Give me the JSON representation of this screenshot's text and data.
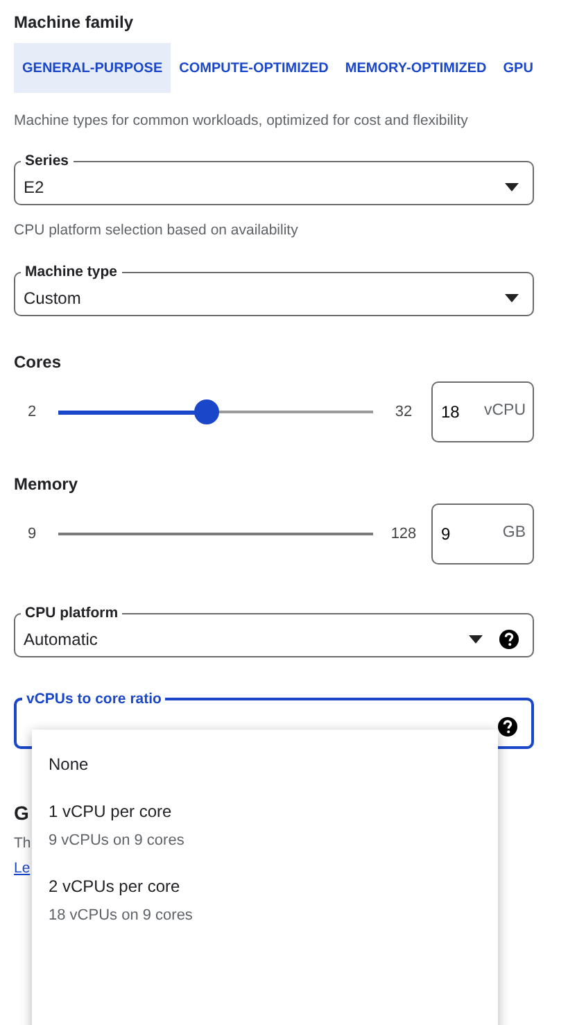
{
  "machine_family": {
    "title": "Machine family",
    "tabs": [
      {
        "label": "GENERAL-PURPOSE",
        "selected": true
      },
      {
        "label": "COMPUTE-OPTIMIZED",
        "selected": false
      },
      {
        "label": "MEMORY-OPTIMIZED",
        "selected": false
      },
      {
        "label": "GPU",
        "selected": false
      }
    ],
    "description": "Machine types for common workloads, optimized for cost and flexibility"
  },
  "series": {
    "label": "Series",
    "value": "E2",
    "open": false,
    "help": false
  },
  "series_hint": "CPU platform selection based on availability",
  "machine_type": {
    "label": "Machine type",
    "value": "Custom",
    "open": false,
    "help": false
  },
  "sliders": [
    {
      "title": "Cores",
      "min": "2",
      "max": "32",
      "level": 0.47,
      "disabled": false,
      "value": "18",
      "unit": "vCPU"
    },
    {
      "title": "Memory",
      "min": "9",
      "max": "128",
      "disabled": true,
      "value": "9",
      "unit": "GB"
    }
  ],
  "cpu_platform": {
    "label": "CPU platform",
    "value": "Automatic",
    "open": false,
    "help": true
  },
  "vcpu_ratio": {
    "label": "vCPUs to core ratio",
    "open": true,
    "help": true
  },
  "behind": {
    "heading": "G",
    "text": "Th",
    "link": "Le"
  },
  "menu": {
    "options": [
      {
        "label": "None"
      },
      {
        "label": "1 vCPU per core",
        "detail": "9 vCPUs on 9 cores"
      },
      {
        "label": "2 vCPUs per core",
        "detail": "18 vCPUs on 9 cores"
      }
    ]
  }
}
